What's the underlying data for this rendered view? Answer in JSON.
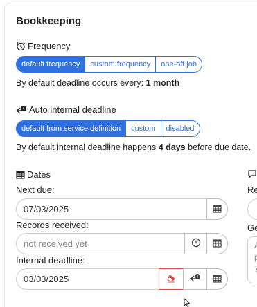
{
  "card": {
    "title": "Bookkeeping"
  },
  "frequency": {
    "label": "Frequency",
    "icon": "alarm-clock-icon",
    "options": [
      "default frequency",
      "custom frequency",
      "one-off job"
    ],
    "active_index": 0,
    "note_prefix": "By default deadline occurs every:",
    "note_value": "1 month"
  },
  "internal_deadline": {
    "label": "Auto internal deadline",
    "icon": "deadline-arrow-icon",
    "options": [
      "default from service definition",
      "custom",
      "disabled"
    ],
    "active_index": 0,
    "note_prefix": "By default internal deadline happens",
    "note_value": "4 days",
    "note_suffix": "before due date."
  },
  "dates": {
    "label": "Dates",
    "icon": "calendar-icon",
    "next_due": {
      "label": "Next due:",
      "value": "07/03/2025"
    },
    "records_received": {
      "label": "Records received:",
      "placeholder": "not received yet"
    },
    "internal_deadline": {
      "label": "Internal deadline:",
      "value": "03/03/2025"
    }
  },
  "right_column": {
    "label_1": "Re",
    "label_2": "Ge",
    "textarea_chars": [
      "A",
      "p",
      "7"
    ]
  },
  "colors": {
    "accent": "#2f6fe0",
    "danger": "#e04848",
    "border": "#cfcfcf"
  }
}
